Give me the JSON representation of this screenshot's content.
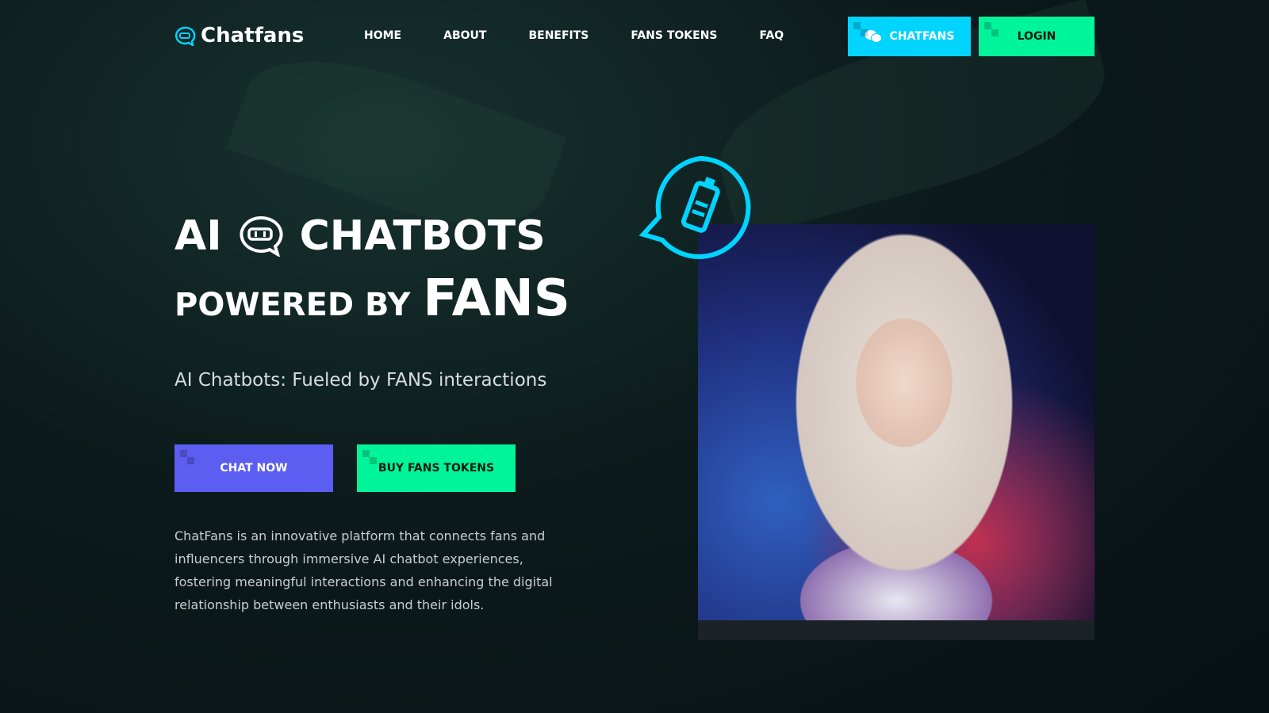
{
  "brand": {
    "name": "Chatfans"
  },
  "nav": [
    "HOME",
    "ABOUT",
    "BENEFITS",
    "FANS TOKENS",
    "FAQ"
  ],
  "header_buttons": {
    "chatfans": "CHATFANS",
    "login": "LOGIN"
  },
  "hero": {
    "line1a": "AI",
    "line1b": "CHATBOTS",
    "line2a": "POWERED BY",
    "line2b": "FANS",
    "subtitle": "AI Chatbots: Fueled by FANS interactions",
    "chat_now": "CHAT NOW",
    "buy_tokens": "BUY FANS TOKENS",
    "description": "ChatFans is an innovative platform that connects fans and influencers through immersive AI chatbot experiences, fostering meaningful interactions and enhancing the digital relationship between enthusiasts and their idols."
  },
  "colors": {
    "cyan": "#00d4ff",
    "green": "#00f59b",
    "purple": "#5b5ef0"
  }
}
